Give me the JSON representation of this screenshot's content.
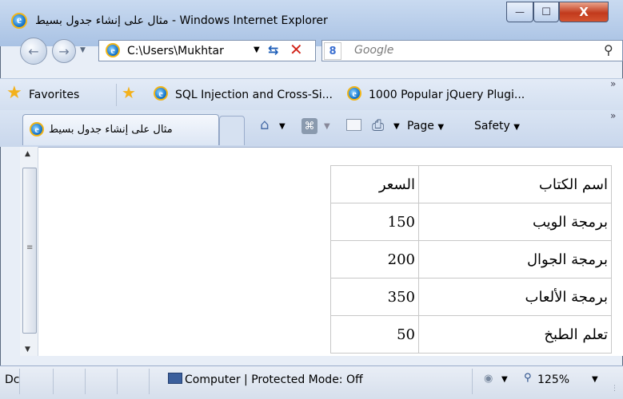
{
  "window": {
    "title": "مثال على إنشاء جدول بسيط - Windows Internet Explorer",
    "controls": {
      "minimize": "—",
      "maximize": "☐",
      "close": "X"
    }
  },
  "nav": {
    "address": "C:\\Users\\Mukhtar",
    "search_placeholder": "Google"
  },
  "favorites": {
    "label": "Favorites",
    "items": [
      {
        "label": "SQL Injection and Cross-Si..."
      },
      {
        "label": "1000 Popular jQuery Plugi..."
      }
    ]
  },
  "tab": {
    "label": "مثال على إنشاء جدول بسيط"
  },
  "toolbar": {
    "page_label": "Page",
    "safety_label": "Safety"
  },
  "table": {
    "header": {
      "name": "اسم الكتاب",
      "price": "السعر"
    },
    "rows": [
      {
        "name": "برمجة الويب",
        "price": "150"
      },
      {
        "name": "برمجة الجوال",
        "price": "200"
      },
      {
        "name": "برمجة الألعاب",
        "price": "350"
      },
      {
        "name": "تعلم الطبخ",
        "price": "50"
      }
    ]
  },
  "status": {
    "text": "Dc",
    "zone": "Computer | Protected Mode: Off",
    "zoom": "125%"
  }
}
